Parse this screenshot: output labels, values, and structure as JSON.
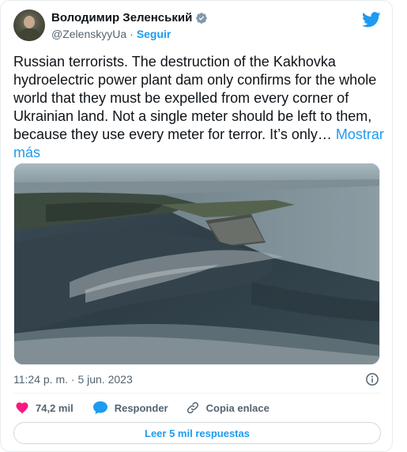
{
  "author": {
    "display_name": "Володимир Зеленський",
    "handle": "@ZelenskyyUa",
    "separator": "·",
    "follow_label": "Seguir"
  },
  "tweet": {
    "text": "Russian terrorists. The destruction of the Kakhovka hydroelectric power plant dam only confirms for the whole world that they must be expelled from every corner of Ukrainian land. Not a single meter should be left to them, because they use every meter for terror. It’s only…",
    "show_more_label": "Mostrar más",
    "timestamp": "11:24 p. m. · 5 jun. 2023"
  },
  "actions": {
    "likes": "74,2 mil",
    "reply_label": "Responder",
    "copy_label": "Copia enlace"
  },
  "footer": {
    "read_replies_label": "Leer 5 mil respuestas"
  },
  "icons": {
    "verified": "verified-badge-icon",
    "brand": "twitter-bird-icon",
    "info": "info-icon",
    "like": "heart-icon",
    "reply": "speech-bubble-icon",
    "copy": "link-icon"
  },
  "colors": {
    "accent": "#1d9bf0",
    "like": "#f91880",
    "text": "#0f1419",
    "muted": "#536471"
  }
}
